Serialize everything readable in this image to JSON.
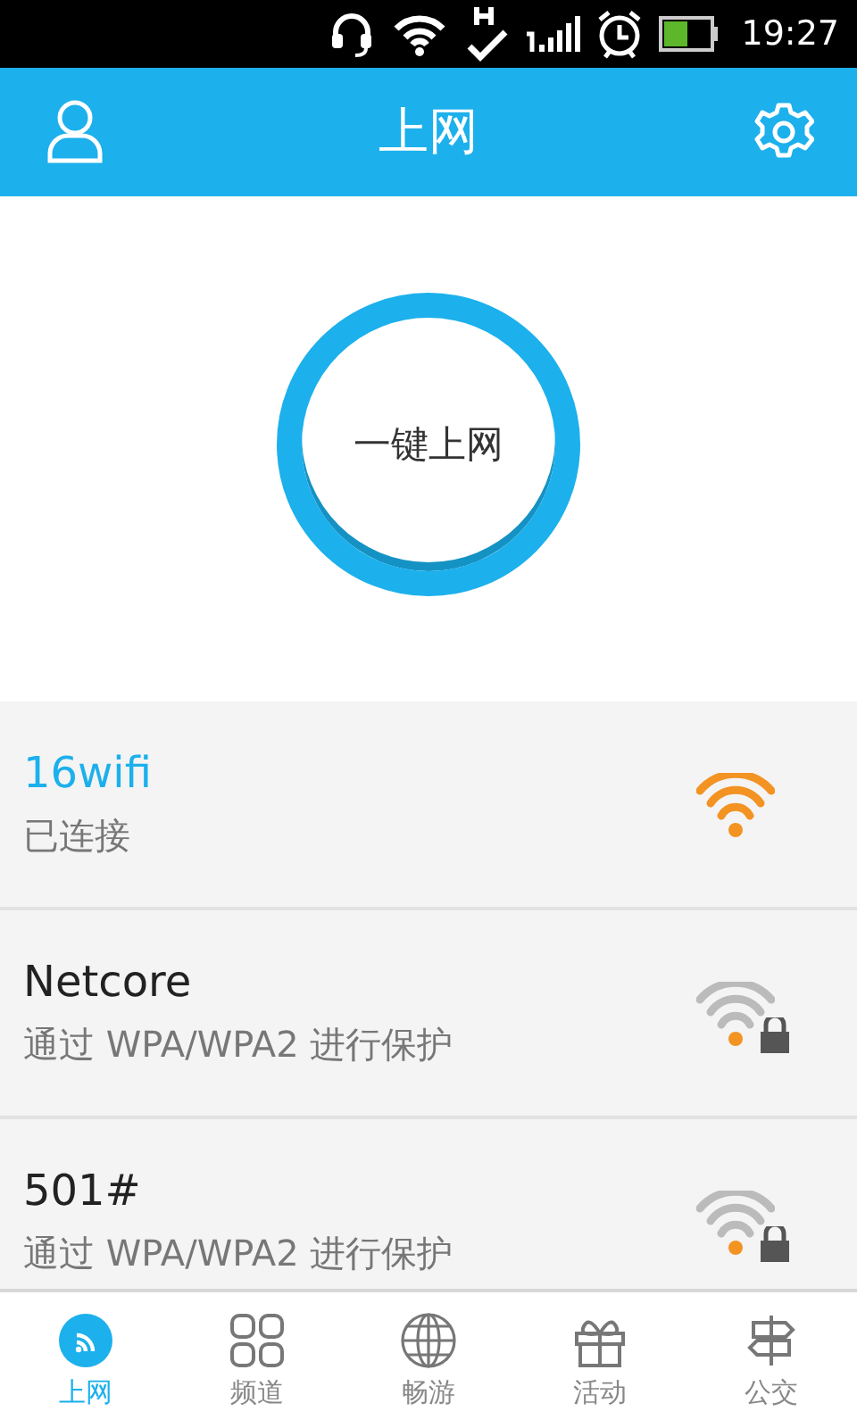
{
  "status_bar": {
    "time": "19:27"
  },
  "header": {
    "title": "上网"
  },
  "connect_button": {
    "label": "一键上网"
  },
  "networks": [
    {
      "name": "16wifi",
      "status": "已连接",
      "connected": true,
      "locked": false
    },
    {
      "name": "Netcore",
      "status": "通过 WPA/WPA2 进行保护",
      "connected": false,
      "locked": true
    },
    {
      "name": "501#",
      "status": "通过 WPA/WPA2 进行保护",
      "connected": false,
      "locked": true
    }
  ],
  "tabs": [
    {
      "label": "上网",
      "kind": "wifi",
      "selected": true
    },
    {
      "label": "频道",
      "kind": "grid",
      "selected": false
    },
    {
      "label": "畅游",
      "kind": "globe",
      "selected": false
    },
    {
      "label": "活动",
      "kind": "gift",
      "selected": false
    },
    {
      "label": "公交",
      "kind": "signpost",
      "selected": false
    }
  ]
}
